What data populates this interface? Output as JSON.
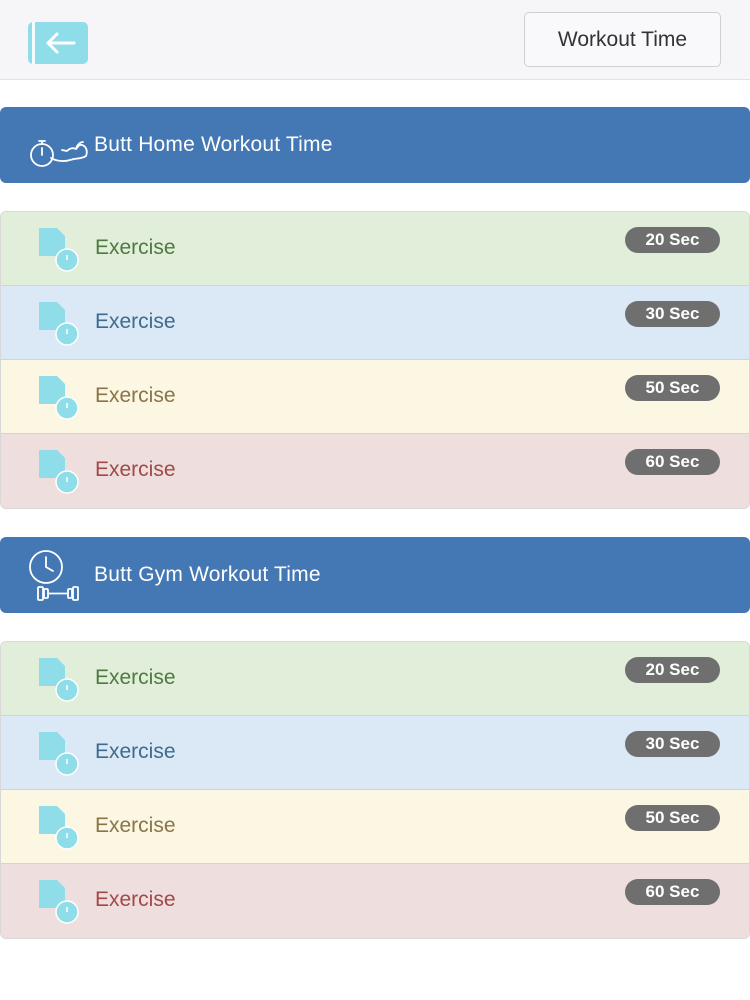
{
  "header": {
    "back_icon": "back-arrow-icon",
    "title_button": "Workout Time"
  },
  "colors": {
    "header_bar": "#4478b5",
    "icon": "#8fdde8",
    "badge": "#6f6f6f",
    "row_green": "#e1eed9",
    "row_blue": "#dae9f5",
    "row_yellow": "#fcf7e2",
    "row_red": "#efdede"
  },
  "sections": [
    {
      "title": "Butt Home Workout Time",
      "icon": "stopwatch-muscle-icon",
      "items": [
        {
          "label": "Exercise",
          "time": "20 Sec",
          "variant": "green"
        },
        {
          "label": "Exercise",
          "time": "30 Sec",
          "variant": "blue"
        },
        {
          "label": "Exercise",
          "time": "50 Sec",
          "variant": "yellow"
        },
        {
          "label": "Exercise",
          "time": "60 Sec",
          "variant": "red"
        }
      ]
    },
    {
      "title": "Butt Gym Workout Time",
      "icon": "clock-dumbbell-icon",
      "items": [
        {
          "label": "Exercise",
          "time": "20 Sec",
          "variant": "green"
        },
        {
          "label": "Exercise",
          "time": "30 Sec",
          "variant": "blue"
        },
        {
          "label": "Exercise",
          "time": "50 Sec",
          "variant": "yellow"
        },
        {
          "label": "Exercise",
          "time": "60 Sec",
          "variant": "red"
        }
      ]
    }
  ]
}
